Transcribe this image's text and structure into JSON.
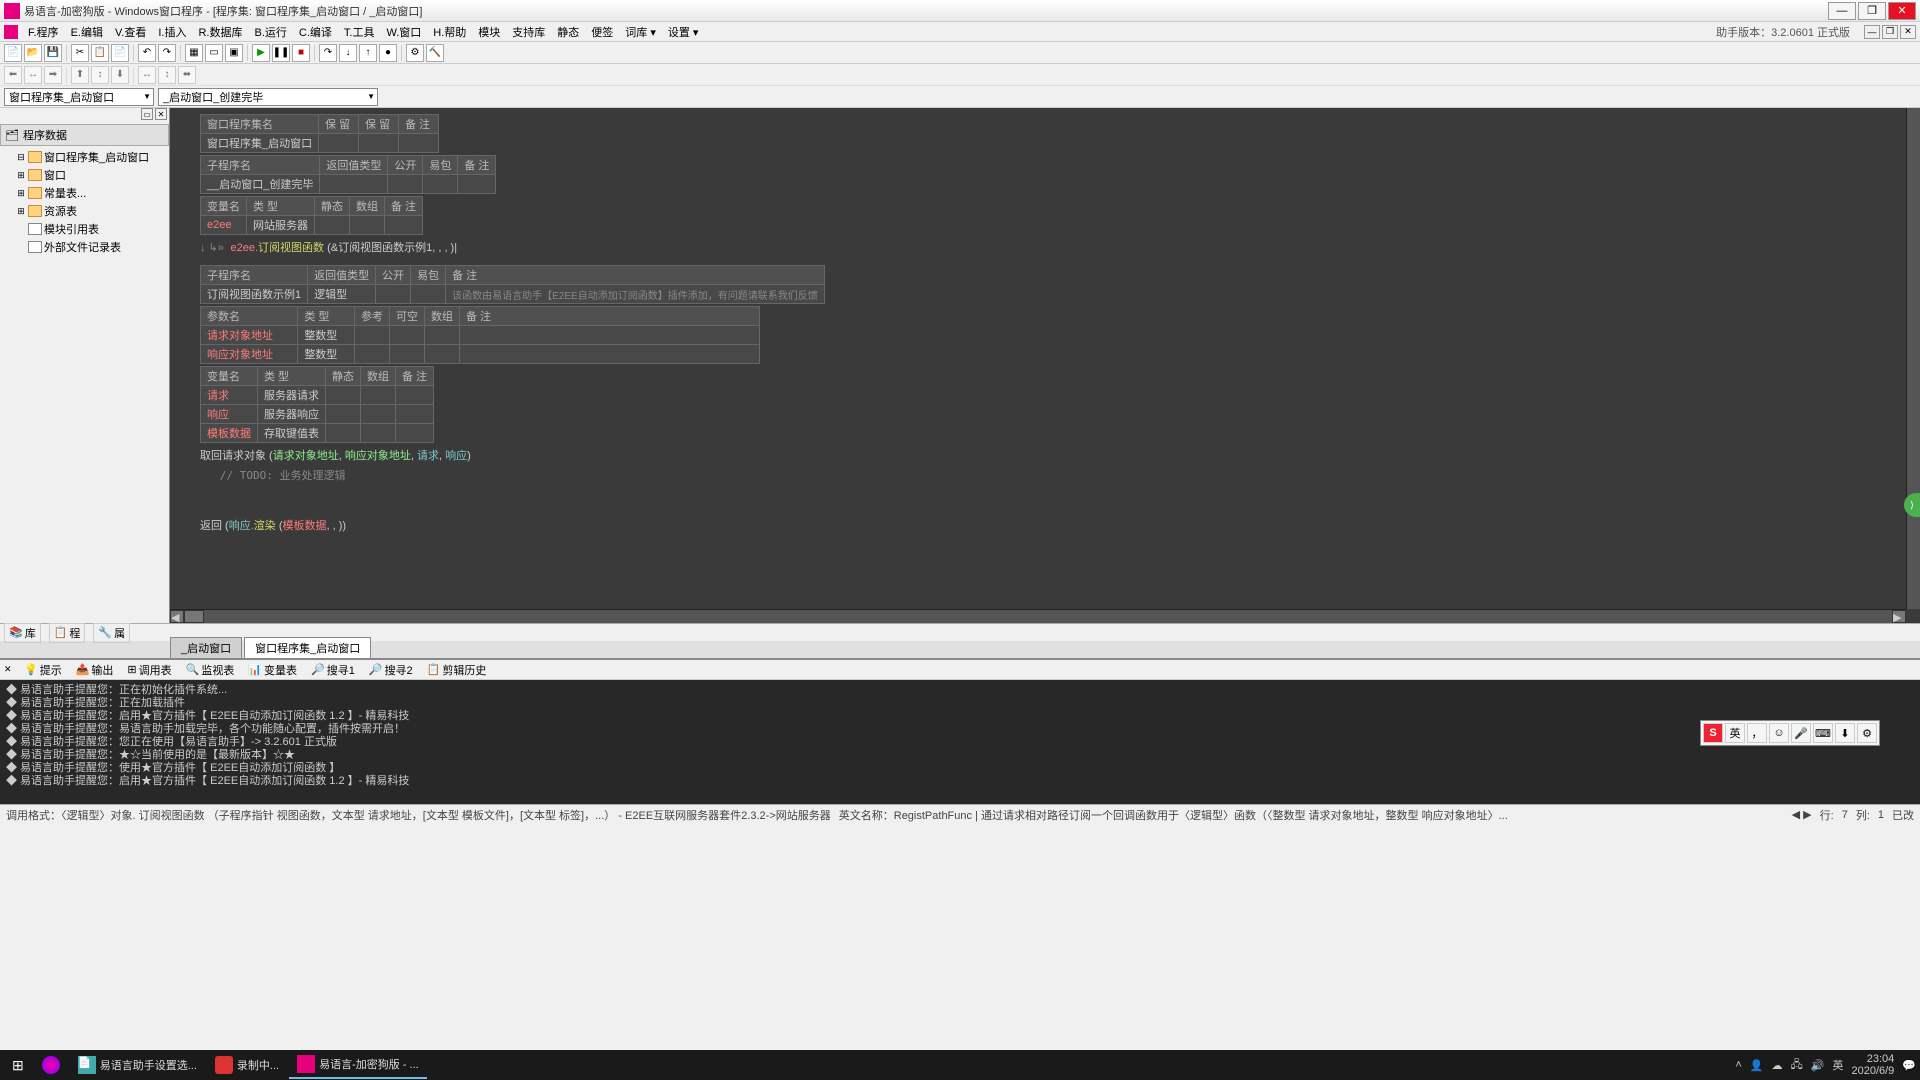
{
  "titlebar": {
    "text": "易语言-加密狗版 - Windows窗口程序 - [程序集: 窗口程序集_启动窗口 / _启动窗口]"
  },
  "menu": {
    "items": [
      "F.程序",
      "E.编辑",
      "V.查看",
      "I.插入",
      "R.数据库",
      "B.运行",
      "C.编译",
      "T.工具",
      "W.窗口",
      "H.帮助",
      "模块",
      "支持库",
      "静态",
      "便签",
      "词库 ▾",
      "设置 ▾"
    ],
    "right": "助手版本：3.2.0601 正式版"
  },
  "combos": {
    "c1": "窗口程序集_启动窗口",
    "c2": "_启动窗口_创建完毕"
  },
  "tree": {
    "title": "程序数据",
    "nodes": [
      {
        "level": 1,
        "exp": "⊟",
        "icon": "folder",
        "label": "窗口程序集_启动窗口"
      },
      {
        "level": 1,
        "exp": "⊞",
        "icon": "folder",
        "label": "窗口"
      },
      {
        "level": 1,
        "exp": "⊞",
        "icon": "folder",
        "label": "常量表..."
      },
      {
        "level": 1,
        "exp": "⊞",
        "icon": "folder",
        "label": "资源表"
      },
      {
        "level": 1,
        "exp": "",
        "icon": "doc",
        "label": "模块引用表"
      },
      {
        "level": 1,
        "exp": "",
        "icon": "doc",
        "label": "外部文件记录表"
      }
    ]
  },
  "editor": {
    "tables": {
      "t1": {
        "headers": [
          "窗口程序集名",
          "保 留",
          "保 留",
          "备 注"
        ],
        "row": [
          "窗口程序集_启动窗口",
          "",
          "",
          ""
        ]
      },
      "t2": {
        "headers": [
          "子程序名",
          "返回值类型",
          "公开",
          "易包",
          "备 注"
        ],
        "row": [
          "__启动窗口_创建完毕",
          "",
          "",
          "",
          ""
        ]
      },
      "t3": {
        "headers": [
          "变量名",
          "类 型",
          "静态",
          "数组",
          "备 注"
        ],
        "row": [
          "e2ee",
          "网站服务器",
          "",
          "",
          ""
        ]
      },
      "t4": {
        "headers": [
          "子程序名",
          "返回值类型",
          "公开",
          "易包",
          "备 注"
        ],
        "row": [
          "订阅视图函数示例1",
          "逻辑型",
          "",
          "",
          "该函数由易语言助手【E2EE自动添加订阅函数】插件添加，有问题请联系我们反馈"
        ]
      },
      "t5": {
        "headers": [
          "参数名",
          "类 型",
          "参考",
          "可空",
          "数组",
          "备 注"
        ],
        "rows": [
          [
            "请求对象地址",
            "整数型",
            "",
            "",
            "",
            ""
          ],
          [
            "响应对象地址",
            "整数型",
            "",
            "",
            "",
            ""
          ]
        ]
      },
      "t6": {
        "headers": [
          "变量名",
          "类 型",
          "静态",
          "数组",
          "备 注"
        ],
        "rows": [
          [
            "请求",
            "服务器请求",
            "",
            "",
            ""
          ],
          [
            "响应",
            "服务器响应",
            "",
            "",
            ""
          ],
          [
            "模板数据",
            "存取键值表",
            "",
            "",
            ""
          ]
        ]
      }
    },
    "code_line1_prefix": "↓ ↳»",
    "code_line1_obj": "e2ee.",
    "code_line1_func": "订阅视图函数",
    "code_line1_args": " (&订阅视图函数示例1, , , )|",
    "code_body1_a": "取回请求对象 (",
    "code_body1_b": "请求对象地址",
    "code_body1_c": ", ",
    "code_body1_d": "响应对象地址",
    "code_body1_e": ", ",
    "code_body1_f": "请求",
    "code_body1_g": ", ",
    "code_body1_h": "响应",
    "code_body1_i": ")",
    "code_comment": "   // TODO: 业务处理逻辑",
    "code_return_a": "返回 (",
    "code_return_b": "响应.",
    "code_return_c": "渲染",
    "code_return_d": " (",
    "code_return_e": "模板数据",
    "code_return_f": ", , ))"
  },
  "bottom_tools": [
    "库",
    "程",
    "属"
  ],
  "editor_tabs": [
    "_启动窗口",
    "窗口程序集_启动窗口"
  ],
  "output": {
    "tabs": [
      "提示",
      "输出",
      "调用表",
      "监视表",
      "变量表",
      "搜寻1",
      "搜寻2",
      "剪辑历史"
    ],
    "lines": [
      "◆ 易语言助手提醒您：正在初始化插件系统...",
      "◆ 易语言助手提醒您：正在加载插件",
      "◆ 易语言助手提醒您：启用★官方插件【 E2EE自动添加订阅函数 1.2 】- 精易科技",
      "◆ 易语言助手提醒您：易语言助手加载完毕，各个功能随心配置，插件按需开启！",
      "◆ 易语言助手提醒您：您正在使用【易语言助手】-> 3.2.601 正式版",
      "",
      "◆ 易语言助手提醒您：★☆当前使用的是【最新版本】☆★",
      "◆ 易语言助手提醒您：使用★官方插件【 E2EE自动添加订阅函数 】",
      "◆ 易语言助手提醒您：启用★官方插件【 E2EE自动添加订阅函数 1.2 】- 精易科技"
    ]
  },
  "statusbar": {
    "left": "调用格式：〈逻辑型〉对象. 订阅视图函数 （子程序指针 视图函数，文本型 请求地址，[文本型 模板文件]，[文本型 标签]，...） - E2EE互联网服务器套件2.3.2->网站服务器",
    "mid": "英文名称：RegistPathFunc  |  通过请求相对路径订阅一个回调函数用于〈逻辑型〉函数（〈整数型 请求对象地址，整数型 响应对象地址〉...",
    "pos1_label": "行:",
    "pos1_val": "7",
    "pos2_label": "列:",
    "pos2_val": "1",
    "changed": "已改"
  },
  "taskbar": {
    "items": [
      {
        "icon": "⊞",
        "label": "",
        "cls": "start"
      },
      {
        "icon": "◐",
        "label": "",
        "cls": "cortana"
      },
      {
        "icon": "📄",
        "label": "易语言助手设置选...",
        "cls": ""
      },
      {
        "icon": "🔴",
        "label": "录制中...",
        "cls": "rec"
      },
      {
        "icon": "📦",
        "label": "易语言-加密狗版 - ...",
        "cls": "active"
      }
    ],
    "tray": {
      "time": "23:04",
      "date": "2020/6/9",
      "ime": "英"
    }
  },
  "ime": {
    "logo": "S",
    "items": [
      "英",
      "，",
      "☺",
      "🎤",
      "⌨",
      "⬇",
      "⚙"
    ]
  }
}
